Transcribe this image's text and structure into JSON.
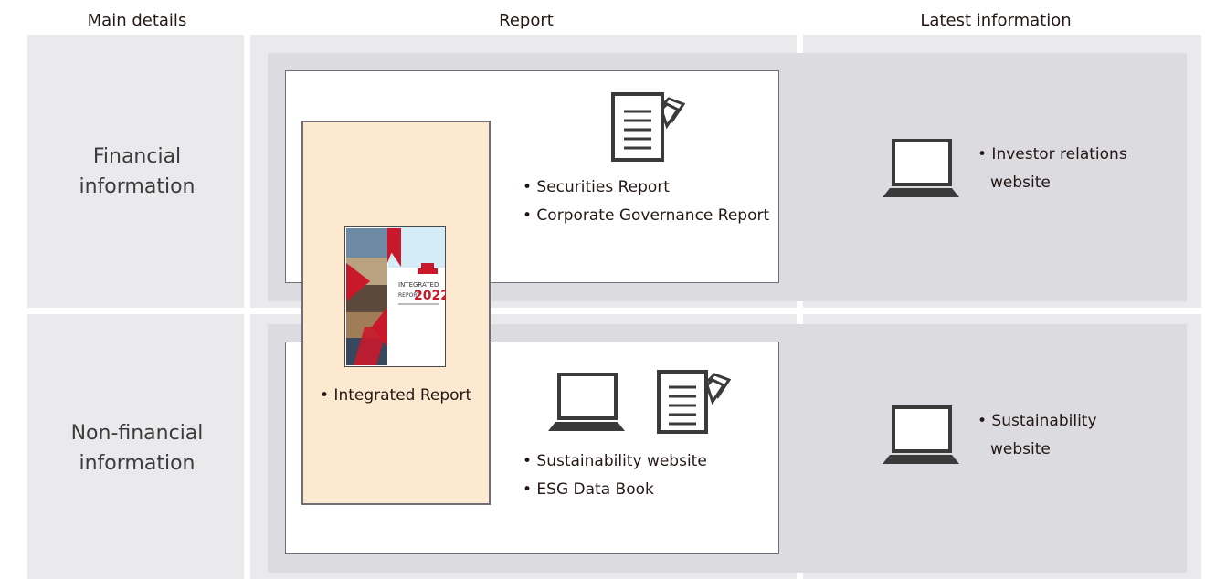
{
  "columns": {
    "main_details": "Main details",
    "report": "Report",
    "latest_information": "Latest information"
  },
  "rows": {
    "financial": {
      "label_line1": "Financial",
      "label_line2": "information"
    },
    "non_financial": {
      "label_line1": "Non-financial",
      "label_line2": "information"
    }
  },
  "integrated": {
    "label": "• Integrated Report",
    "cover": {
      "line1": "INTEGRATED",
      "line2": "REPORT",
      "year": "2022"
    }
  },
  "financial_report": {
    "items": [
      "• Securities Report",
      "• Corporate Governance Report"
    ]
  },
  "non_financial_report": {
    "items": [
      "• Sustainability website",
      "• ESG Data Book"
    ]
  },
  "latest": {
    "financial_line1": "• Investor relations",
    "financial_line2": "website",
    "non_financial_line1": "• Sustainability",
    "non_financial_line2": "website"
  },
  "icons": {
    "document": "document-icon",
    "laptop": "laptop-icon"
  },
  "colors": {
    "cell_bg": "#eae9ec",
    "band_bg": "#dcdbe0",
    "integrated_bg": "#fde8d0",
    "cover_red": "#c8182a",
    "outline": "#3a3a3a"
  }
}
